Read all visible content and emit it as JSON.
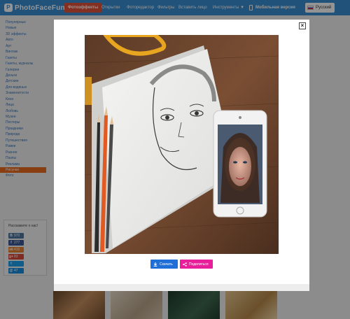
{
  "site": {
    "logo": "PhotoFaceFun",
    "logo_mark": "P"
  },
  "nav": {
    "active": "Фотоэффекты",
    "items": [
      "Открытки",
      "Фоторедактор",
      "Фильтры",
      "Вставить лицо",
      "Инструменты ▼"
    ],
    "mobile": "Мобильная версия",
    "language": "Русский"
  },
  "sidebar": {
    "categories": [
      "Популярные",
      "Новые",
      "3D эффекты",
      "Авто",
      "Арт",
      "Винтаж",
      "Газеты",
      "Газеты, журналы",
      "Галереи",
      "Деньги",
      "Детские",
      "Для водяных",
      "Знаменитости",
      "Кино",
      "Лица",
      "Любовь",
      "Музеи",
      "Постеры",
      "Праздники",
      "Природа",
      "Путешествия",
      "Рамки",
      "Разное",
      "Пазлы",
      "Реклама",
      "Рисунки",
      "Фото"
    ],
    "active": "Рисунки"
  },
  "share": {
    "title": "Расскажите о нас!",
    "networks": [
      {
        "name": "vk",
        "icon": "В",
        "count": "970",
        "color": "#4c75a3"
      },
      {
        "name": "facebook",
        "icon": "f",
        "count": "277",
        "color": "#3b5998"
      },
      {
        "name": "odnoklassniki",
        "icon": "ok",
        "count": "415",
        "color": "#ed812b"
      },
      {
        "name": "google-plus",
        "icon": "g+",
        "count": "83",
        "color": "#dd4b39"
      },
      {
        "name": "twitter",
        "icon": "t",
        "count": "",
        "color": "#1da1f2"
      },
      {
        "name": "mail-ru",
        "icon": "@",
        "count": "47",
        "color": "#168de2"
      }
    ]
  },
  "modal": {
    "close": "×",
    "download_label": "Скачать",
    "share_label": "Поделиться"
  },
  "colors": {
    "topbar": "#3a8dd0",
    "accent": "#e2543b",
    "sidebar_active": "#ec6b20",
    "download": "#1e6fd8",
    "share": "#e81e9a"
  }
}
